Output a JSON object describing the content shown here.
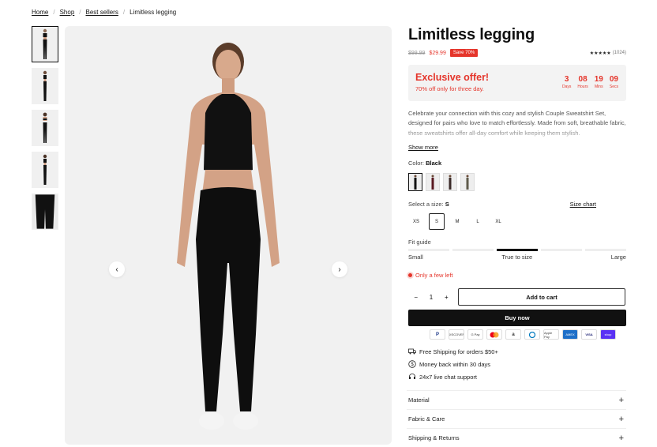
{
  "breadcrumb": {
    "items": [
      "Home",
      "Shop",
      "Best sellers"
    ],
    "current": "Limitless legging",
    "sep": "/"
  },
  "product": {
    "title": "Limitless legging",
    "old_price": "$99.99",
    "price": "$29.99",
    "save_badge": "Save 70%",
    "rating_stars": "★★★★★",
    "rating_count": "(1024)"
  },
  "offer": {
    "title": "Exclusive offer!",
    "subtitle": "70% off only for three day.",
    "countdown": [
      {
        "value": "3",
        "unit": "Days"
      },
      {
        "value": "08",
        "unit": "Hours"
      },
      {
        "value": "19",
        "unit": "Mins"
      },
      {
        "value": "09",
        "unit": "Secs"
      }
    ]
  },
  "description": "Celebrate your connection with this cozy and stylish Couple Sweatshirt Set, designed for pairs who love to match effortlessly. Made from soft, breathable fabric, these sweatshirts offer all-day comfort while keeping them stylish.",
  "show_more": "Show more",
  "color": {
    "label": "Color:",
    "value": "Black"
  },
  "size": {
    "label": "Select a size:",
    "value": "S",
    "chart_link": "Size chart",
    "options": [
      "XS",
      "S",
      "M",
      "L",
      "XL"
    ]
  },
  "fit": {
    "label": "Fit guide",
    "small": "Small",
    "middle": "True to size",
    "large": "Large"
  },
  "stock": "Only a few left",
  "qty": {
    "minus": "−",
    "value": "1",
    "plus": "+"
  },
  "buttons": {
    "add_to_cart": "Add to cart",
    "buy_now": "Buy now"
  },
  "payments": [
    "PayPal",
    "DISCOVER",
    "G Pay",
    "MC",
    "Amazon",
    "Diners",
    "Apple Pay",
    "AMEX",
    "VISA",
    "shop"
  ],
  "features": [
    "Free Shipping for orders $50+",
    "Money back within 30 days",
    "24x7 live chat support"
  ],
  "accordion": [
    "Material",
    "Fabric & Care",
    "Shipping & Returns"
  ],
  "nav": {
    "prev": "‹",
    "next": "›"
  },
  "colors": {
    "accent": "#e5352b",
    "dark": "#111111",
    "offer_bg": "#f3f3f3"
  }
}
